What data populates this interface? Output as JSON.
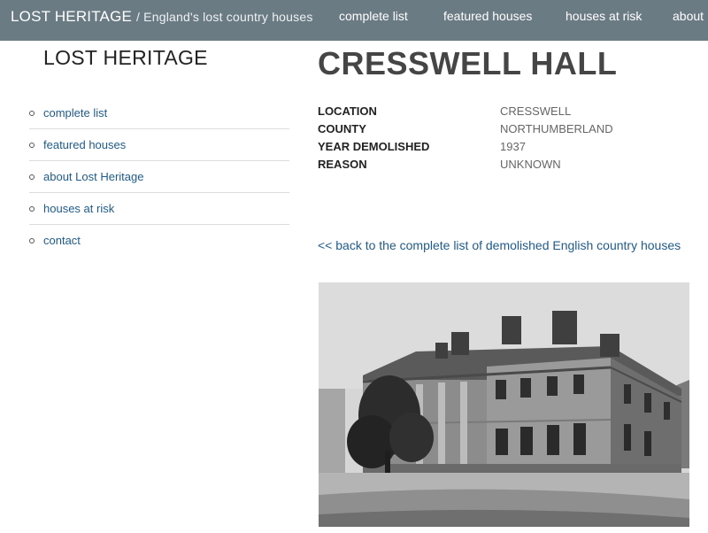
{
  "header": {
    "brand": "LOST HERITAGE",
    "tagline": "/ England's lost country houses",
    "nav": [
      "complete list",
      "featured houses",
      "houses at risk",
      "about"
    ]
  },
  "sidebar": {
    "title": "LOST HERITAGE",
    "items": [
      {
        "label": "complete list"
      },
      {
        "label": "featured houses"
      },
      {
        "label": "about Lost Heritage"
      },
      {
        "label": "houses at risk"
      },
      {
        "label": "contact"
      }
    ]
  },
  "house": {
    "name": "CRESSWELL HALL",
    "facts": [
      {
        "label": "LOCATION",
        "value": "CRESSWELL"
      },
      {
        "label": "COUNTY",
        "value": "NORTHUMBERLAND"
      },
      {
        "label": "YEAR DEMOLISHED",
        "value": "1937"
      },
      {
        "label": "REASON",
        "value": "UNKNOWN"
      }
    ],
    "back_link": "<< back to the complete list of demolished English country houses"
  },
  "colors": {
    "header_bg": "#6b7b84",
    "link": "#1f5b8a"
  }
}
